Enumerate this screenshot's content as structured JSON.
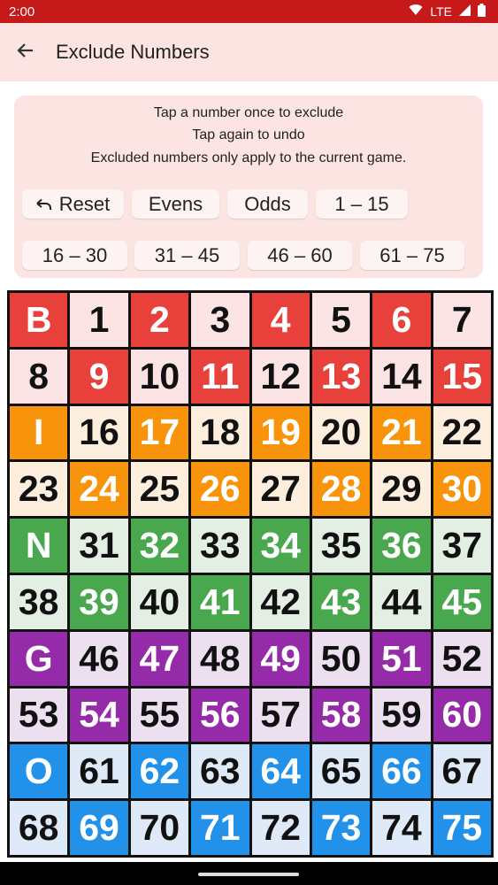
{
  "status": {
    "time": "2:00",
    "network": "LTE"
  },
  "appbar": {
    "title": "Exclude Numbers"
  },
  "instructions": [
    "Tap a number once to exclude",
    "Tap again to undo",
    "Excluded numbers only apply to the current game."
  ],
  "buttons": {
    "reset": "Reset",
    "evens": "Evens",
    "odds": "Odds",
    "r1": "1 – 15",
    "r2": "16 – 30",
    "r3": "31 – 45",
    "r4": "46 – 60",
    "r5": "61 – 75"
  },
  "colors": {
    "B": {
      "dark": "#e8403a",
      "light": "#fbe4e3"
    },
    "I": {
      "dark": "#f7940b",
      "light": "#fdeedd"
    },
    "N": {
      "dark": "#49a84d",
      "light": "#e3efe2"
    },
    "G": {
      "dark": "#962ba9",
      "light": "#ecdff0"
    },
    "O": {
      "dark": "#2291ea",
      "light": "#dfeaf8"
    }
  },
  "grid": [
    [
      "B",
      "1",
      "2",
      "3",
      "4",
      "5",
      "6",
      "7"
    ],
    [
      "8",
      "9",
      "10",
      "11",
      "12",
      "13",
      "14",
      "15"
    ],
    [
      "I",
      "16",
      "17",
      "18",
      "19",
      "20",
      "21",
      "22"
    ],
    [
      "23",
      "24",
      "25",
      "26",
      "27",
      "28",
      "29",
      "30"
    ],
    [
      "N",
      "31",
      "32",
      "33",
      "34",
      "35",
      "36",
      "37"
    ],
    [
      "38",
      "39",
      "40",
      "41",
      "42",
      "43",
      "44",
      "45"
    ],
    [
      "G",
      "46",
      "47",
      "48",
      "49",
      "50",
      "51",
      "52"
    ],
    [
      "53",
      "54",
      "55",
      "56",
      "57",
      "58",
      "59",
      "60"
    ],
    [
      "O",
      "61",
      "62",
      "63",
      "64",
      "65",
      "66",
      "67"
    ],
    [
      "68",
      "69",
      "70",
      "71",
      "72",
      "73",
      "74",
      "75"
    ]
  ]
}
